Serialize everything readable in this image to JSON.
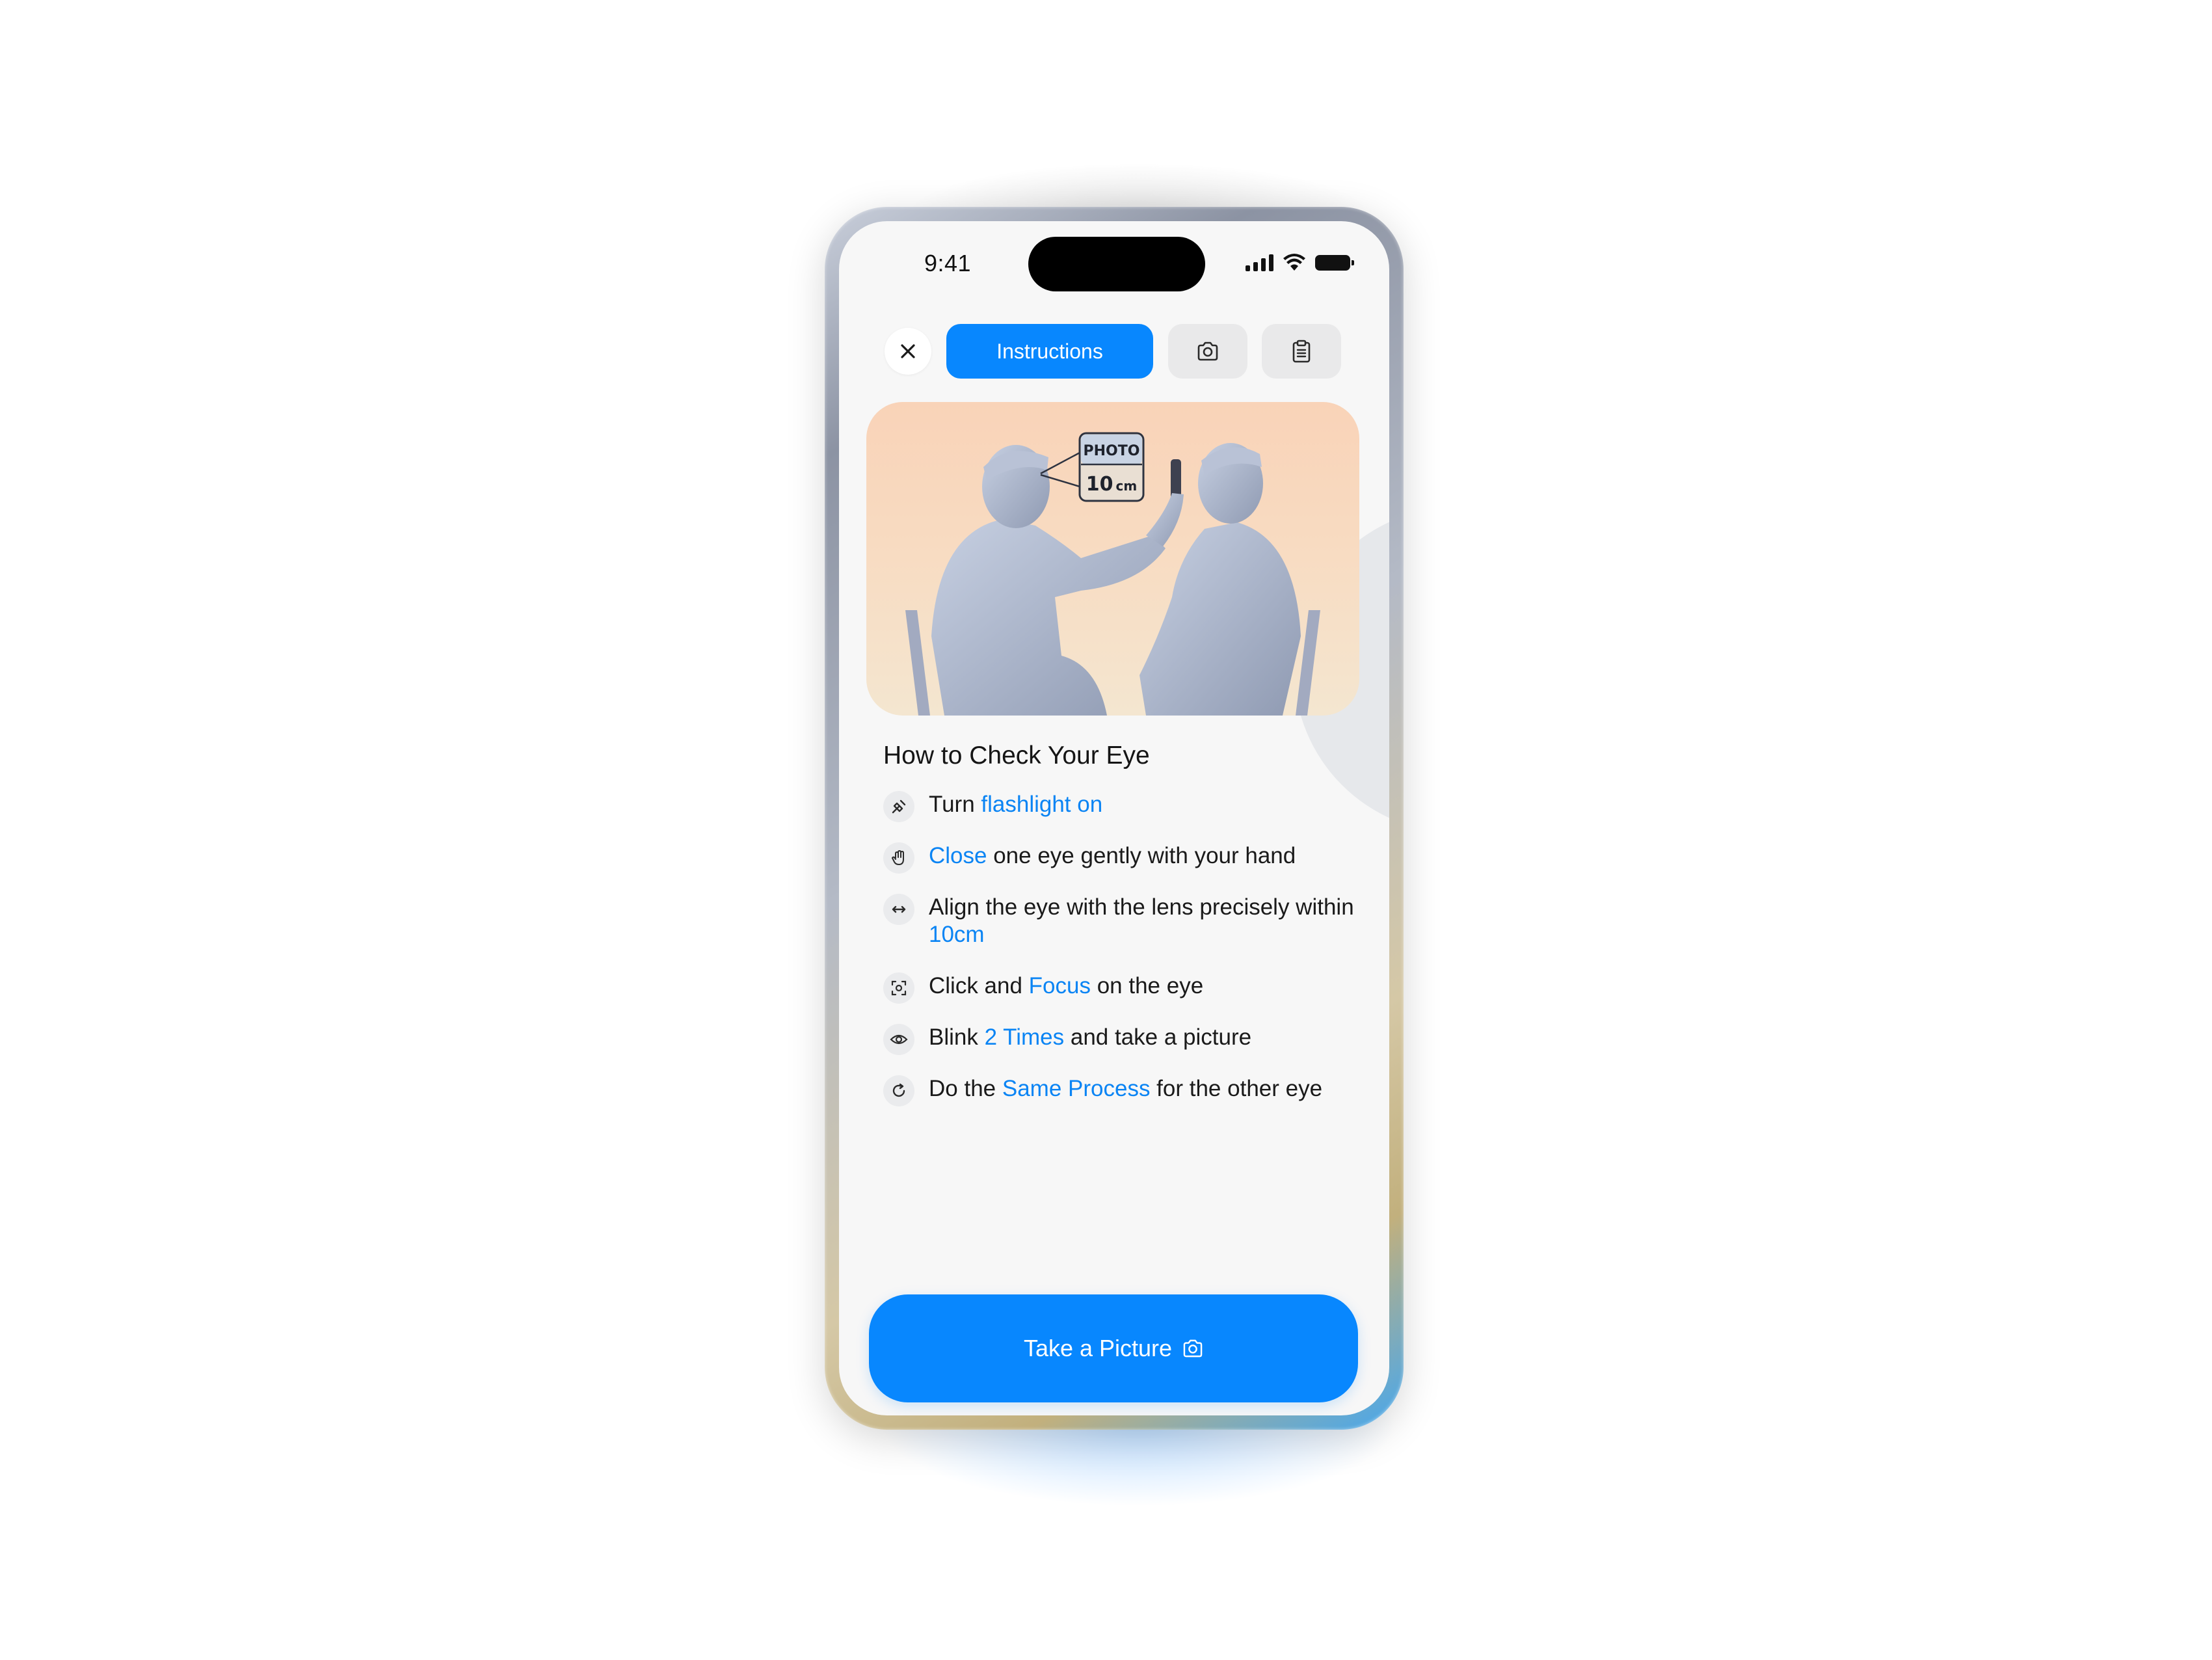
{
  "status_bar": {
    "time": "9:41"
  },
  "toolbar": {
    "close_icon": "close-icon",
    "tabs": [
      {
        "label": "Instructions",
        "active": true
      },
      {
        "icon": "camera-icon",
        "active": false
      },
      {
        "icon": "clipboard-icon",
        "active": false
      }
    ]
  },
  "hero": {
    "label_photo": "PHOTO",
    "label_distance_value": "10",
    "label_distance_unit": "cm"
  },
  "section": {
    "title": "How to Check Your Eye"
  },
  "steps": [
    {
      "icon": "flashlight-icon",
      "before": "Turn ",
      "highlight": "flashlight on",
      "after": ""
    },
    {
      "icon": "hand-icon",
      "before": "",
      "highlight": "Close",
      "after": " one eye gently with your hand"
    },
    {
      "icon": "align-arrows-icon",
      "before": "Align the eye with the lens precisely within ",
      "highlight": "10cm",
      "after": ""
    },
    {
      "icon": "focus-icon",
      "before": "Click and ",
      "highlight": "Focus",
      "after": " on the eye"
    },
    {
      "icon": "eye-icon",
      "before": "Blink ",
      "highlight": "2 Times",
      "after": " and take a picture"
    },
    {
      "icon": "refresh-icon",
      "before": "Do the ",
      "highlight": "Same Process",
      "after": " for the other eye"
    }
  ],
  "cta": {
    "label": "Take a Picture",
    "icon": "camera-icon"
  },
  "colors": {
    "accent": "#0887fe",
    "highlight": "#0a84f4",
    "screen_bg": "#f7f7f7"
  }
}
